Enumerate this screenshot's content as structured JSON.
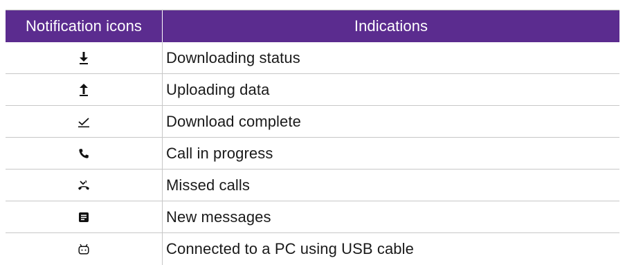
{
  "table": {
    "headers": {
      "icons": "Notification icons",
      "indications": "Indications"
    },
    "rows": [
      {
        "icon": "download-arrow-icon",
        "indication": "Downloading status"
      },
      {
        "icon": "upload-arrow-icon",
        "indication": "Uploading data"
      },
      {
        "icon": "download-complete-check-icon",
        "indication": "Download complete"
      },
      {
        "icon": "phone-call-icon",
        "indication": "Call in progress"
      },
      {
        "icon": "missed-call-icon",
        "indication": "Missed calls"
      },
      {
        "icon": "message-icon",
        "indication": "New messages"
      },
      {
        "icon": "android-usb-icon",
        "indication": "Connected to a PC using USB cable"
      }
    ]
  },
  "colors": {
    "header_background": "#5b2c8f",
    "header_text": "#ffffff",
    "grid_lines": "#c7c7c7"
  }
}
